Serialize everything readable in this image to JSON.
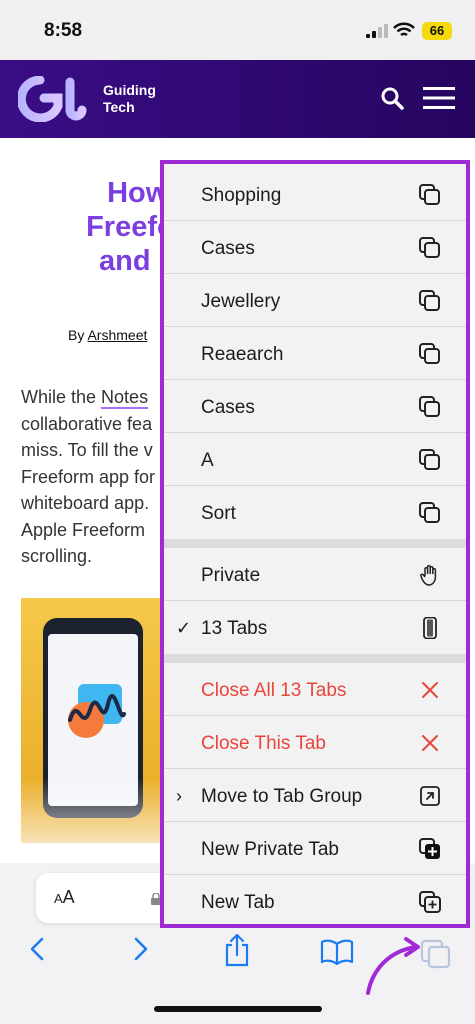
{
  "status": {
    "time": "8:58",
    "battery": "66"
  },
  "header": {
    "brand_line1": "Guiding",
    "brand_line2": "Tech"
  },
  "article": {
    "title_lines": [
      "How t",
      "Freefor",
      "and iP"
    ],
    "byline_prefix": "By ",
    "byline_author": "Arshmeet",
    "body_lines": [
      "While the ",
      "collaborative fea",
      "miss. To fill the v",
      "Freeform app for",
      "whiteboard app.",
      "Apple Freeform",
      "scrolling."
    ],
    "body_link": "Notes"
  },
  "toolbar": {
    "text_size_label": "AA"
  },
  "menu": {
    "groups": [
      {
        "label": "Shopping",
        "icon": "tabs-icon"
      },
      {
        "label": "Cases",
        "icon": "tabs-icon"
      },
      {
        "label": "Jewellery",
        "icon": "tabs-icon"
      },
      {
        "label": "Reaearch",
        "icon": "tabs-icon"
      },
      {
        "label": "Cases",
        "icon": "tabs-icon"
      },
      {
        "label": "A",
        "icon": "tabs-icon"
      },
      {
        "label": "Sort",
        "icon": "tabs-icon"
      }
    ],
    "private": {
      "label": "Private",
      "icon": "hand-icon"
    },
    "current": {
      "label": "13 Tabs",
      "icon": "phone-icon",
      "checked": true
    },
    "close_all": {
      "label": "Close All 13 Tabs",
      "icon": "x-icon"
    },
    "close_this": {
      "label": "Close This Tab",
      "icon": "x-icon"
    },
    "move": {
      "label": "Move to Tab Group",
      "icon": "arrow-up-right-icon"
    },
    "new_private": {
      "label": "New Private Tab",
      "icon": "plus-square-filled-icon"
    },
    "new_tab": {
      "label": "New Tab",
      "icon": "plus-square-icon"
    }
  },
  "colors": {
    "accent": "#a02bd6",
    "destructive": "#e8453c",
    "link": "#007aff",
    "header": "#2f0a72"
  }
}
